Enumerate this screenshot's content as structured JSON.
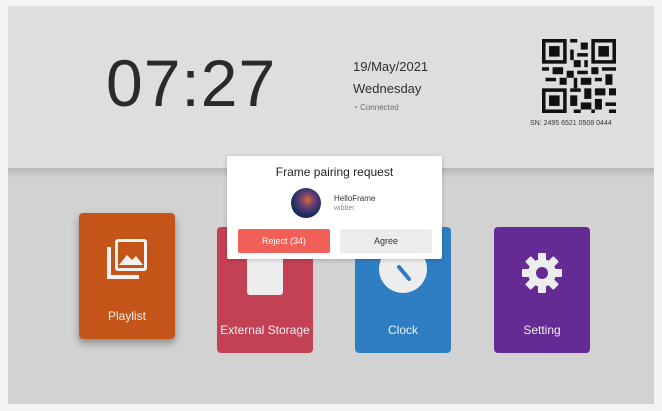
{
  "status": {
    "time": "07:27",
    "date": "19/May/2021",
    "weekday": "Wednesday",
    "connection": "Connected",
    "serial": "SN: 2495 6521 0508 0444"
  },
  "apps": [
    {
      "label": "Playlist",
      "color": "#c55418",
      "icon": "photo-gallery-icon"
    },
    {
      "label": "External Storage",
      "color": "#c34154",
      "icon": "storage-icon"
    },
    {
      "label": "Clock",
      "color": "#2f7ec4",
      "icon": "clock-icon"
    },
    {
      "label": "Setting",
      "color": "#632b93",
      "icon": "gear-icon"
    }
  ],
  "dialog": {
    "title": "Frame pairing request",
    "device_name": "HelloFrame",
    "device_user": "wibber",
    "reject_label": "Reject (34)",
    "agree_label": "Agree",
    "reject_color": "#f06058"
  }
}
